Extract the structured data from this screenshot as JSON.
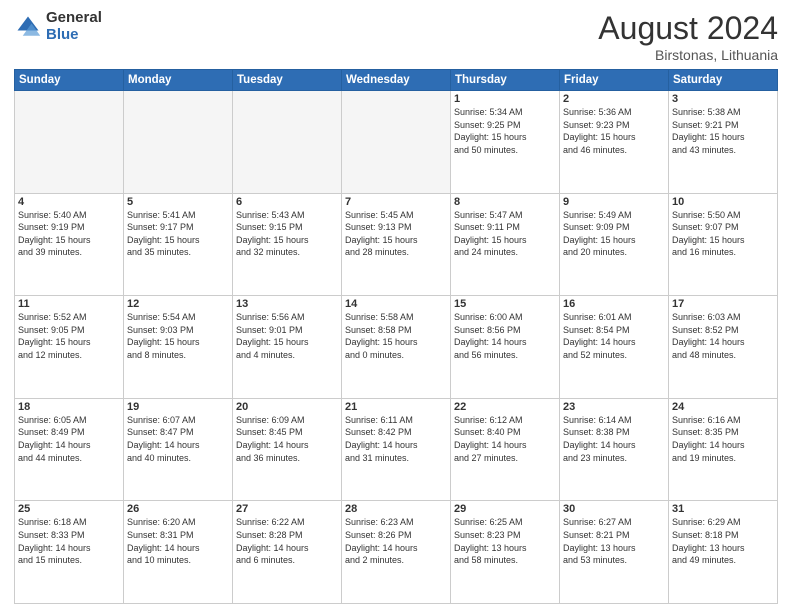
{
  "header": {
    "logo_general": "General",
    "logo_blue": "Blue",
    "month_year": "August 2024",
    "location": "Birstonas, Lithuania"
  },
  "days_of_week": [
    "Sunday",
    "Monday",
    "Tuesday",
    "Wednesday",
    "Thursday",
    "Friday",
    "Saturday"
  ],
  "weeks": [
    [
      {
        "day": "",
        "info": ""
      },
      {
        "day": "",
        "info": ""
      },
      {
        "day": "",
        "info": ""
      },
      {
        "day": "",
        "info": ""
      },
      {
        "day": "1",
        "info": "Sunrise: 5:34 AM\nSunset: 9:25 PM\nDaylight: 15 hours\nand 50 minutes."
      },
      {
        "day": "2",
        "info": "Sunrise: 5:36 AM\nSunset: 9:23 PM\nDaylight: 15 hours\nand 46 minutes."
      },
      {
        "day": "3",
        "info": "Sunrise: 5:38 AM\nSunset: 9:21 PM\nDaylight: 15 hours\nand 43 minutes."
      }
    ],
    [
      {
        "day": "4",
        "info": "Sunrise: 5:40 AM\nSunset: 9:19 PM\nDaylight: 15 hours\nand 39 minutes."
      },
      {
        "day": "5",
        "info": "Sunrise: 5:41 AM\nSunset: 9:17 PM\nDaylight: 15 hours\nand 35 minutes."
      },
      {
        "day": "6",
        "info": "Sunrise: 5:43 AM\nSunset: 9:15 PM\nDaylight: 15 hours\nand 32 minutes."
      },
      {
        "day": "7",
        "info": "Sunrise: 5:45 AM\nSunset: 9:13 PM\nDaylight: 15 hours\nand 28 minutes."
      },
      {
        "day": "8",
        "info": "Sunrise: 5:47 AM\nSunset: 9:11 PM\nDaylight: 15 hours\nand 24 minutes."
      },
      {
        "day": "9",
        "info": "Sunrise: 5:49 AM\nSunset: 9:09 PM\nDaylight: 15 hours\nand 20 minutes."
      },
      {
        "day": "10",
        "info": "Sunrise: 5:50 AM\nSunset: 9:07 PM\nDaylight: 15 hours\nand 16 minutes."
      }
    ],
    [
      {
        "day": "11",
        "info": "Sunrise: 5:52 AM\nSunset: 9:05 PM\nDaylight: 15 hours\nand 12 minutes."
      },
      {
        "day": "12",
        "info": "Sunrise: 5:54 AM\nSunset: 9:03 PM\nDaylight: 15 hours\nand 8 minutes."
      },
      {
        "day": "13",
        "info": "Sunrise: 5:56 AM\nSunset: 9:01 PM\nDaylight: 15 hours\nand 4 minutes."
      },
      {
        "day": "14",
        "info": "Sunrise: 5:58 AM\nSunset: 8:58 PM\nDaylight: 15 hours\nand 0 minutes."
      },
      {
        "day": "15",
        "info": "Sunrise: 6:00 AM\nSunset: 8:56 PM\nDaylight: 14 hours\nand 56 minutes."
      },
      {
        "day": "16",
        "info": "Sunrise: 6:01 AM\nSunset: 8:54 PM\nDaylight: 14 hours\nand 52 minutes."
      },
      {
        "day": "17",
        "info": "Sunrise: 6:03 AM\nSunset: 8:52 PM\nDaylight: 14 hours\nand 48 minutes."
      }
    ],
    [
      {
        "day": "18",
        "info": "Sunrise: 6:05 AM\nSunset: 8:49 PM\nDaylight: 14 hours\nand 44 minutes."
      },
      {
        "day": "19",
        "info": "Sunrise: 6:07 AM\nSunset: 8:47 PM\nDaylight: 14 hours\nand 40 minutes."
      },
      {
        "day": "20",
        "info": "Sunrise: 6:09 AM\nSunset: 8:45 PM\nDaylight: 14 hours\nand 36 minutes."
      },
      {
        "day": "21",
        "info": "Sunrise: 6:11 AM\nSunset: 8:42 PM\nDaylight: 14 hours\nand 31 minutes."
      },
      {
        "day": "22",
        "info": "Sunrise: 6:12 AM\nSunset: 8:40 PM\nDaylight: 14 hours\nand 27 minutes."
      },
      {
        "day": "23",
        "info": "Sunrise: 6:14 AM\nSunset: 8:38 PM\nDaylight: 14 hours\nand 23 minutes."
      },
      {
        "day": "24",
        "info": "Sunrise: 6:16 AM\nSunset: 8:35 PM\nDaylight: 14 hours\nand 19 minutes."
      }
    ],
    [
      {
        "day": "25",
        "info": "Sunrise: 6:18 AM\nSunset: 8:33 PM\nDaylight: 14 hours\nand 15 minutes."
      },
      {
        "day": "26",
        "info": "Sunrise: 6:20 AM\nSunset: 8:31 PM\nDaylight: 14 hours\nand 10 minutes."
      },
      {
        "day": "27",
        "info": "Sunrise: 6:22 AM\nSunset: 8:28 PM\nDaylight: 14 hours\nand 6 minutes."
      },
      {
        "day": "28",
        "info": "Sunrise: 6:23 AM\nSunset: 8:26 PM\nDaylight: 14 hours\nand 2 minutes."
      },
      {
        "day": "29",
        "info": "Sunrise: 6:25 AM\nSunset: 8:23 PM\nDaylight: 13 hours\nand 58 minutes."
      },
      {
        "day": "30",
        "info": "Sunrise: 6:27 AM\nSunset: 8:21 PM\nDaylight: 13 hours\nand 53 minutes."
      },
      {
        "day": "31",
        "info": "Sunrise: 6:29 AM\nSunset: 8:18 PM\nDaylight: 13 hours\nand 49 minutes."
      }
    ]
  ]
}
